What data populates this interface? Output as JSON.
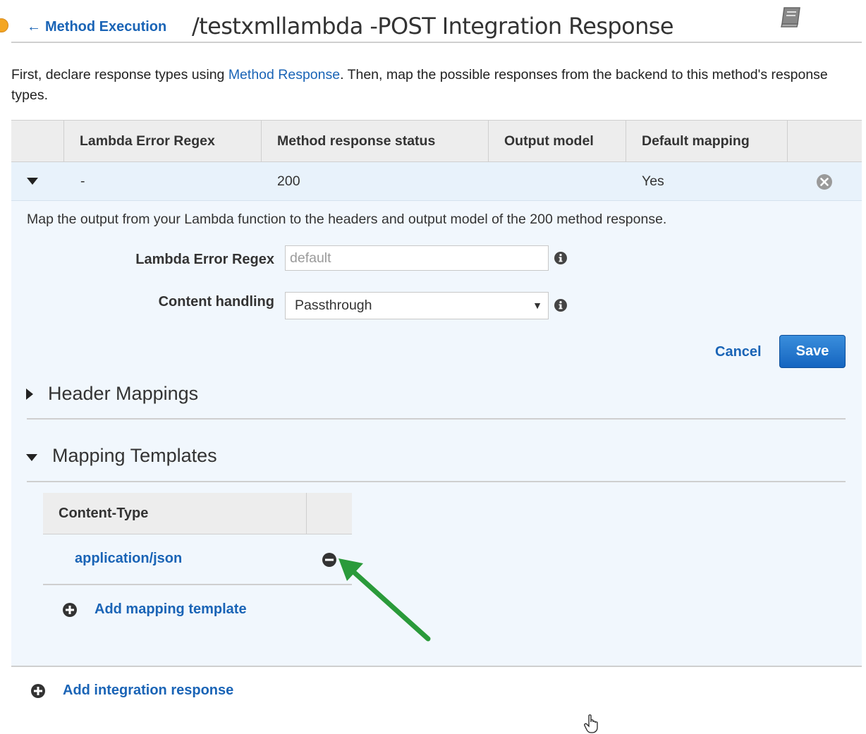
{
  "header": {
    "back_link": "Method Execution",
    "title": "/testxmllambda -POST  Integration Response"
  },
  "intro": {
    "prefix": "First, declare response types using ",
    "link": "Method Response",
    "suffix": ". Then, map the possible responses from the backend to this method's response types."
  },
  "table": {
    "columns": [
      "Lambda Error Regex",
      "Method response status",
      "Output model",
      "Default mapping"
    ],
    "row": {
      "regex": "-",
      "status": "200",
      "output_model": "",
      "default_mapping": "Yes"
    }
  },
  "panel": {
    "description": "Map the output from your Lambda function to the headers and output model of the 200 method response.",
    "regex_label": "Lambda Error Regex",
    "regex_value": "",
    "regex_placeholder": "default",
    "content_handling_label": "Content handling",
    "content_handling_value": "Passthrough",
    "cancel_label": "Cancel",
    "save_label": "Save"
  },
  "sections": {
    "header_mappings": "Header Mappings",
    "mapping_templates": "Mapping Templates"
  },
  "templates": {
    "header": "Content-Type",
    "items": [
      "application/json"
    ],
    "add_label": "Add mapping template"
  },
  "footer": {
    "add_response_label": "Add integration response"
  },
  "colors": {
    "link": "#1a64b6",
    "save_button": "#1f74c9",
    "row_highlight": "#e8f2fb",
    "annotation_arrow": "#2a9a3a"
  }
}
